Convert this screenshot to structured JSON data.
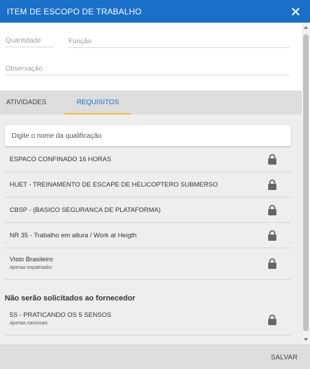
{
  "dialog": {
    "title": "ITEM DE ESCOPO DE TRABALHO",
    "close_icon": "close-icon"
  },
  "form": {
    "quantidade_placeholder": "Quantidade",
    "funcao_placeholder": "Função",
    "observacao_placeholder": "Observação"
  },
  "tabs": [
    {
      "label": "ATIVIDADES",
      "active": false
    },
    {
      "label": "REQUISITOS",
      "active": true
    }
  ],
  "search": {
    "placeholder": "Digite o nome da qualificação",
    "value": ""
  },
  "requisitos": [
    {
      "name": "ESPACO CONFINADO 16 HORAS",
      "note": "",
      "icon": "lock-icon"
    },
    {
      "name": "HUET - TREINAMENTO DE ESCAPE DE HELICOPTERO SUBMERSO",
      "note": "",
      "icon": "lock-icon"
    },
    {
      "name": "CBSP - (BASICO SEGURANCA DE PLATAFORMA)",
      "note": "",
      "icon": "lock-icon"
    },
    {
      "name": "NR 35 - Trabalho em altura / Work at Heigth",
      "note": "",
      "icon": "lock-icon"
    },
    {
      "name": "Visto Brasileiro",
      "note": "Apenas expatriados",
      "icon": "lock-icon"
    }
  ],
  "nao_solicitados": {
    "title": "Não serão solicitados ao fornecedor",
    "items": [
      {
        "name": "5S - PRATICANDO OS 5 SENSOS",
        "note": "Apenas nacionais",
        "icon": "lock-icon"
      }
    ]
  },
  "footer": {
    "save_label": "SALVAR"
  },
  "colors": {
    "header": "#1a6fc9",
    "tab_active_text": "#1a6fc9",
    "tab_indicator": "#f0c31a",
    "footer": "#dddddd"
  }
}
